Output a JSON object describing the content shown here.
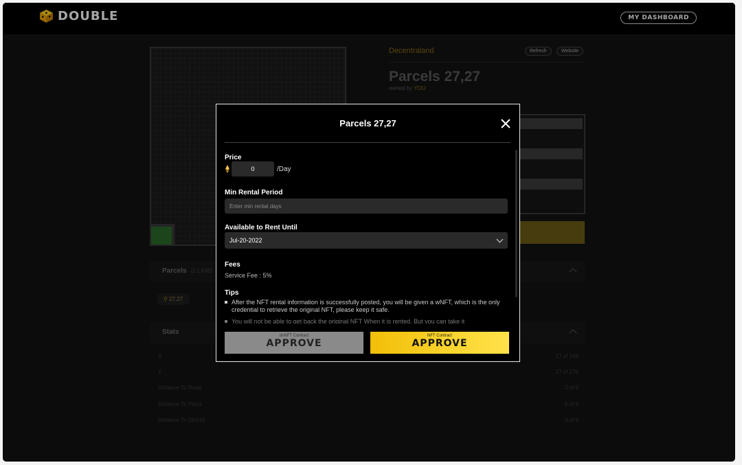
{
  "header": {
    "brand": "DOUBLE",
    "dashboard_label": "MY DASHBOARD"
  },
  "land": {
    "collection": "Decentraland",
    "refresh_label": "Refresh",
    "website_label": "Website",
    "title": "Parcels 27,27",
    "owned_prefix": "owned by ",
    "owner": "YOU"
  },
  "parcels_section": {
    "title": "Parcels",
    "subtitle": "(1 LAND",
    "chip": "27,27"
  },
  "stats_section": {
    "title": "Stats",
    "rows": [
      {
        "label": "X",
        "value": "27 of 168"
      },
      {
        "label": "Y",
        "value": "27 of 170"
      },
      {
        "label": "Distance To Road",
        "value": "2 of 9"
      },
      {
        "label": "Distance To Plaza",
        "value": "5 of 9"
      },
      {
        "label": "Distance To District",
        "value": "3 of 9"
      }
    ]
  },
  "modal": {
    "title": "Parcels 27,27",
    "price_label": "Price",
    "price_value": "0",
    "price_unit": "/Day",
    "min_rental_label": "Min Rental Period",
    "min_rental_placeholder": "Enter min rental days",
    "available_label": "Available to Rent Until",
    "available_value": "Jul-20-2022",
    "fees_label": "Fees",
    "service_fee": "Service Fee : 5%",
    "tips_label": "Tips",
    "tips": [
      "After the NFT rental information is successfully posted, you will be given a wNFT, which is the only credential to retrieve the original NFT, please keep it safe.",
      "You will not be able to get back the original NFT When it is rented. But you can take it"
    ],
    "btn_donft_caption": "doNFT Contract",
    "btn_donft_label": "APPROVE",
    "btn_nft_caption": "NFT Contract",
    "btn_nft_label": "APPROVE"
  },
  "colors": {
    "accent": "#f2bf08",
    "owner": "#8a6a13"
  }
}
